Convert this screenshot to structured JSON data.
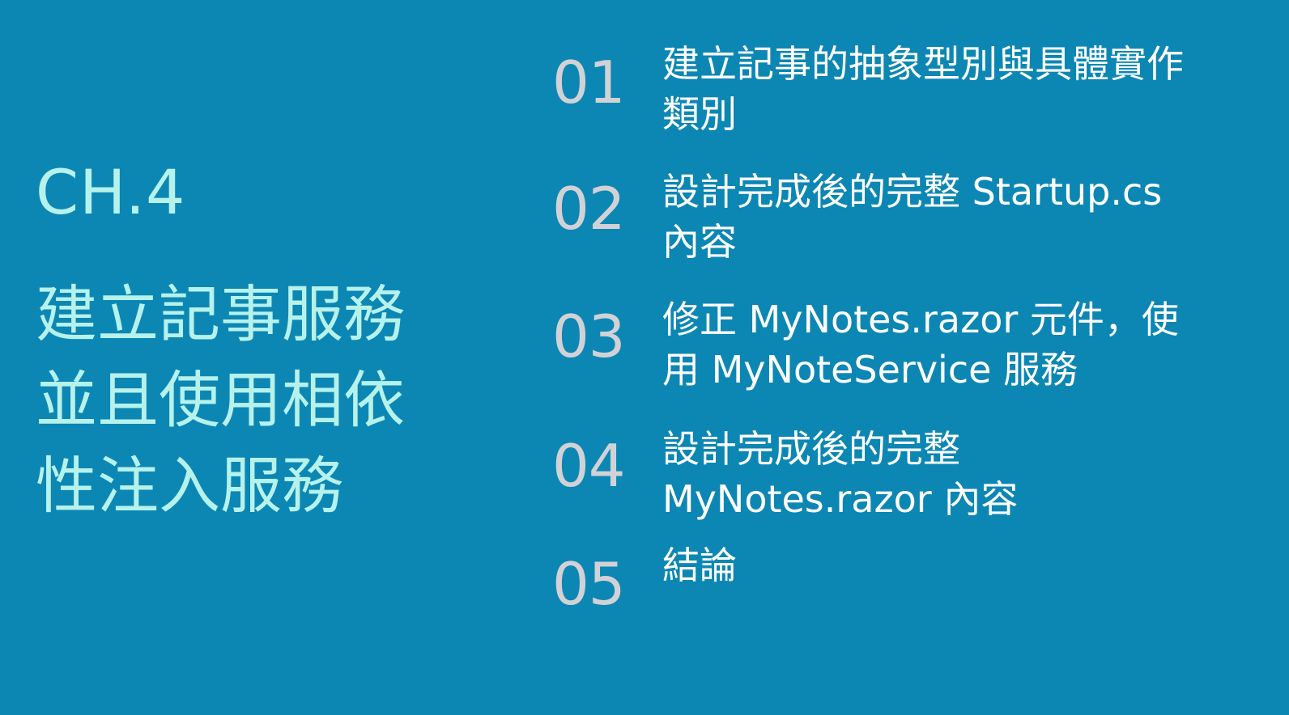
{
  "chapter": "CH.4",
  "title_lines": [
    "建立記事服務",
    "並且使用相依",
    "性注入服務"
  ],
  "items": [
    {
      "number": "01",
      "lines": [
        "建立記事的抽象型別與具體實作",
        "類別"
      ]
    },
    {
      "number": "02",
      "lines": [
        "設計完成後的完整 Startup.cs",
        "內容"
      ]
    },
    {
      "number": "03",
      "lines": [
        "修正 MyNotes.razor 元件，使",
        "用 MyNoteService 服務"
      ]
    },
    {
      "number": "04",
      "lines": [
        "設計完成後的完整",
        "MyNotes.razor 內容"
      ]
    },
    {
      "number": "05",
      "lines": [
        "結論"
      ]
    }
  ],
  "colors": {
    "background": "#0c87b3",
    "title": "#b6f2ec",
    "number": "#d2d2d6",
    "item_text": "#ffffff"
  }
}
